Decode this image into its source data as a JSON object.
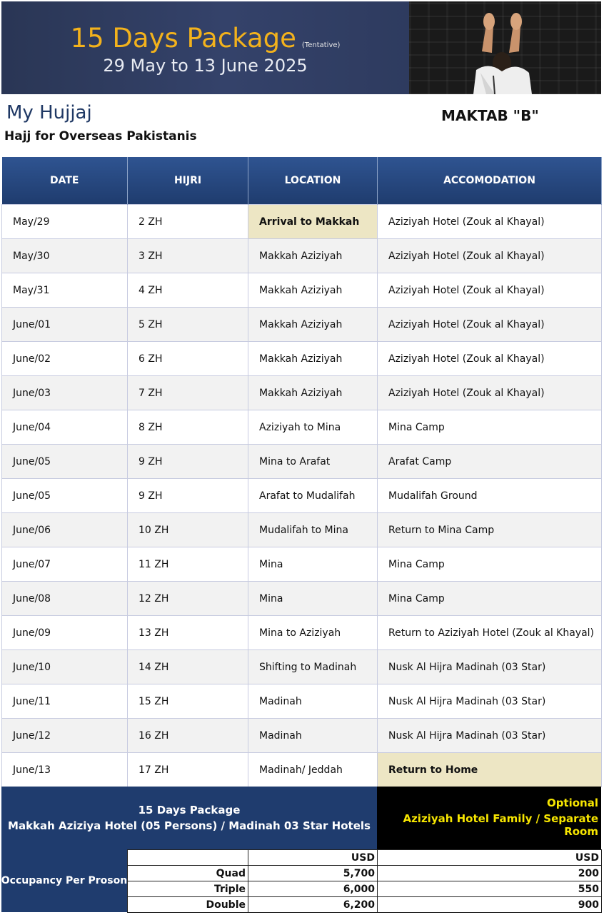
{
  "banner": {
    "title": "15 Days Package",
    "tentative": "(Tentative)",
    "dates": "29 May to 13 June 2025"
  },
  "brand": {
    "name": "My Hujjaj",
    "subtitle": "Hajj for Overseas Pakistanis"
  },
  "maktab": "MAKTAB \"B\"",
  "schedule": {
    "headers": [
      "DATE",
      "HIJRI",
      "LOCATION",
      "ACCOMODATION"
    ],
    "rows": [
      [
        "May/29",
        "2 ZH",
        "Arrival to Makkah",
        "Aziziyah Hotel (Zouk al Khayal)"
      ],
      [
        "May/30",
        "3 ZH",
        "Makkah Aziziyah",
        "Aziziyah Hotel (Zouk al Khayal)"
      ],
      [
        "May/31",
        "4 ZH",
        "Makkah Aziziyah",
        "Aziziyah Hotel (Zouk al Khayal)"
      ],
      [
        "June/01",
        "5 ZH",
        "Makkah Aziziyah",
        "Aziziyah Hotel (Zouk al Khayal)"
      ],
      [
        "June/02",
        "6 ZH",
        "Makkah Aziziyah",
        "Aziziyah Hotel (Zouk al Khayal)"
      ],
      [
        "June/03",
        "7 ZH",
        "Makkah Aziziyah",
        "Aziziyah Hotel (Zouk al Khayal)"
      ],
      [
        "June/04",
        "8 ZH",
        "Aziziyah to Mina",
        "Mina Camp"
      ],
      [
        "June/05",
        "9 ZH",
        "Mina to Arafat",
        "Arafat Camp"
      ],
      [
        "June/05",
        "9 ZH",
        "Arafat to Mudalifah",
        "Mudalifah Ground"
      ],
      [
        "June/06",
        "10 ZH",
        "Mudalifah to Mina",
        "Return to Mina Camp"
      ],
      [
        "June/07",
        "11 ZH",
        "Mina",
        "Mina Camp"
      ],
      [
        "June/08",
        "12 ZH",
        "Mina",
        "Mina Camp"
      ],
      [
        "June/09",
        "13 ZH",
        "Mina to Aziziyah",
        "Return to Aziziyah Hotel (Zouk al Khayal)"
      ],
      [
        "June/10",
        "14 ZH",
        "Shifting to Madinah",
        "Nusk Al Hijra Madinah (03 Star)"
      ],
      [
        "June/11",
        "15 ZH",
        "Madinah",
        "Nusk Al Hijra Madinah (03 Star)"
      ],
      [
        "June/12",
        "16 ZH",
        "Madinah",
        "Nusk Al Hijra Madinah (03 Star)"
      ],
      [
        "June/13",
        "17 ZH",
        "Madinah/ Jeddah",
        "Return to Home"
      ]
    ]
  },
  "package": {
    "line1": "15 Days Package",
    "line2": "Makkah Aziziya Hotel (05 Persons) / Madinah 03 Star Hotels"
  },
  "optional": {
    "line1": "Optional",
    "line2": "Aziziyah Hotel Family / Separate Room"
  },
  "pricing": {
    "label": "Occupancy Per Proson",
    "currency": "USD",
    "rows": [
      {
        "type": "Quad",
        "price": "5,700",
        "optional": "200"
      },
      {
        "type": "Triple",
        "price": "6,000",
        "optional": "550"
      },
      {
        "type": "Double",
        "price": "6,200",
        "optional": "900"
      }
    ]
  },
  "colors": {
    "navy": "#1f3c6e",
    "banner_title": "#f3b21c",
    "optional_text": "#f7e600",
    "highlight_cell": "#ede6c4"
  }
}
